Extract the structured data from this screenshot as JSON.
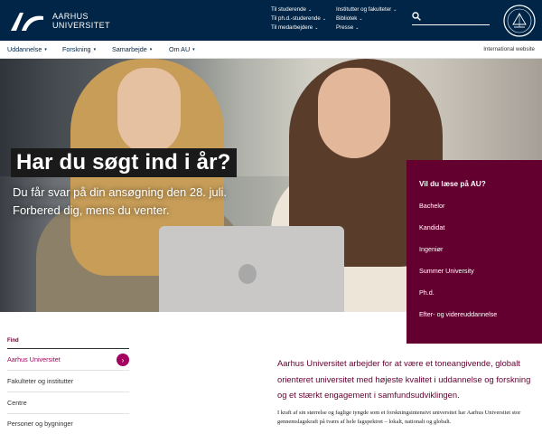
{
  "header": {
    "logo_line1": "AARHUS",
    "logo_line2": "UNIVERSITET",
    "quicklinks_col1": [
      "Til studerende",
      "Til ph.d.-studerende",
      "Til medarbejdere"
    ],
    "quicklinks_col2": [
      "Institutter og fakulteter",
      "Bibliotek",
      "Presse"
    ],
    "search_icon": "search-icon",
    "seal_icon": "university-seal-icon",
    "brand_color": "#002546"
  },
  "nav": {
    "items": [
      "Uddannelse",
      "Forskning",
      "Samarbejde",
      "Om AU"
    ],
    "international": "International website"
  },
  "hero": {
    "headline": "Har du søgt ind i år?",
    "sub_line1": "Du får svar på din ansøgning den 28. juli.",
    "sub_line2": "Forbered dig, mens du venter."
  },
  "study": {
    "title": "Vil du læse på AU?",
    "links": [
      "Bachelor",
      "Kandidat",
      "Ingeniør",
      "Summer University",
      "Ph.d.",
      "Efter- og videreuddannelse"
    ],
    "panel_color": "#63002f"
  },
  "find": {
    "label": "Find",
    "items": [
      "Aarhus Universitet",
      "Fakulteter og institutter",
      "Centre",
      "Personer og bygninger"
    ],
    "active_color": "#a3005f"
  },
  "content": {
    "lead": "Aarhus Universitet arbejder for at være et toneangivende, globalt orienteret universitet med højeste kvalitet i uddannelse og forskning og et stærkt engagement i samfundsudviklingen.",
    "body": "I kraft af sin størrelse og faglige tyngde som et forskningsintensivt universitet har Aarhus Universitet stor gennemslagskraft på tværs af hele fagspektret – lokalt, nationalt og globalt."
  }
}
